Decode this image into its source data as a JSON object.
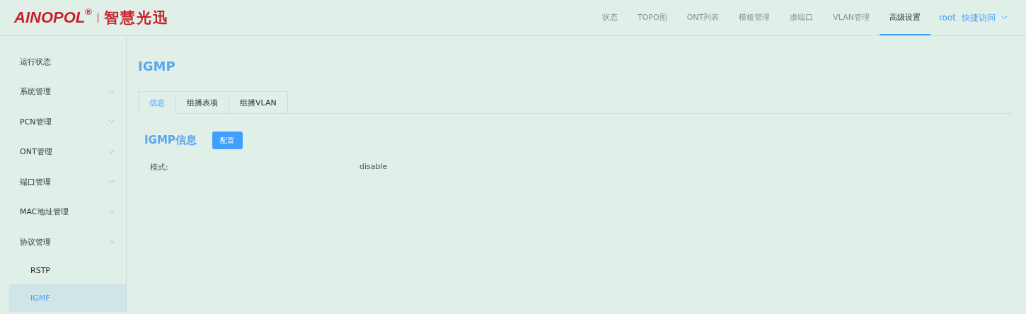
{
  "logo": {
    "brand": "AINOPOL",
    "mark": "®",
    "tagline": "智慧光迅"
  },
  "nav": [
    {
      "label": "状态",
      "selected": false
    },
    {
      "label": "TOPO图",
      "selected": false
    },
    {
      "label": "ONT列表",
      "selected": false
    },
    {
      "label": "模板管理",
      "selected": false
    },
    {
      "label": "虚端口",
      "selected": false
    },
    {
      "label": "VLAN管理",
      "selected": false
    },
    {
      "label": "高级设置",
      "selected": true
    }
  ],
  "user": "root",
  "quick_access": "快捷访问",
  "sidebar": {
    "items": [
      {
        "label": "运行状态",
        "kind": "link"
      },
      {
        "label": "系统管理",
        "kind": "group",
        "expanded": false
      },
      {
        "label": "PCN管理",
        "kind": "group",
        "expanded": false
      },
      {
        "label": "ONT管理",
        "kind": "group",
        "expanded": false
      },
      {
        "label": "端口管理",
        "kind": "group",
        "expanded": false
      },
      {
        "label": "MAC地址管理",
        "kind": "group",
        "expanded": false
      },
      {
        "label": "协议管理",
        "kind": "group",
        "expanded": true,
        "children": [
          {
            "label": "RSTP",
            "selected": false
          },
          {
            "label": "IGMF",
            "selected": true
          }
        ]
      }
    ]
  },
  "page_title": "IGMP",
  "tabs": [
    {
      "label": "信息",
      "selected": true
    },
    {
      "label": "组播表项",
      "selected": false
    },
    {
      "label": "组播VLAN",
      "selected": false
    }
  ],
  "section": {
    "title": "IGMP信息",
    "button": "配置",
    "fields": [
      {
        "label": "模式:",
        "value": "disable"
      }
    ]
  }
}
